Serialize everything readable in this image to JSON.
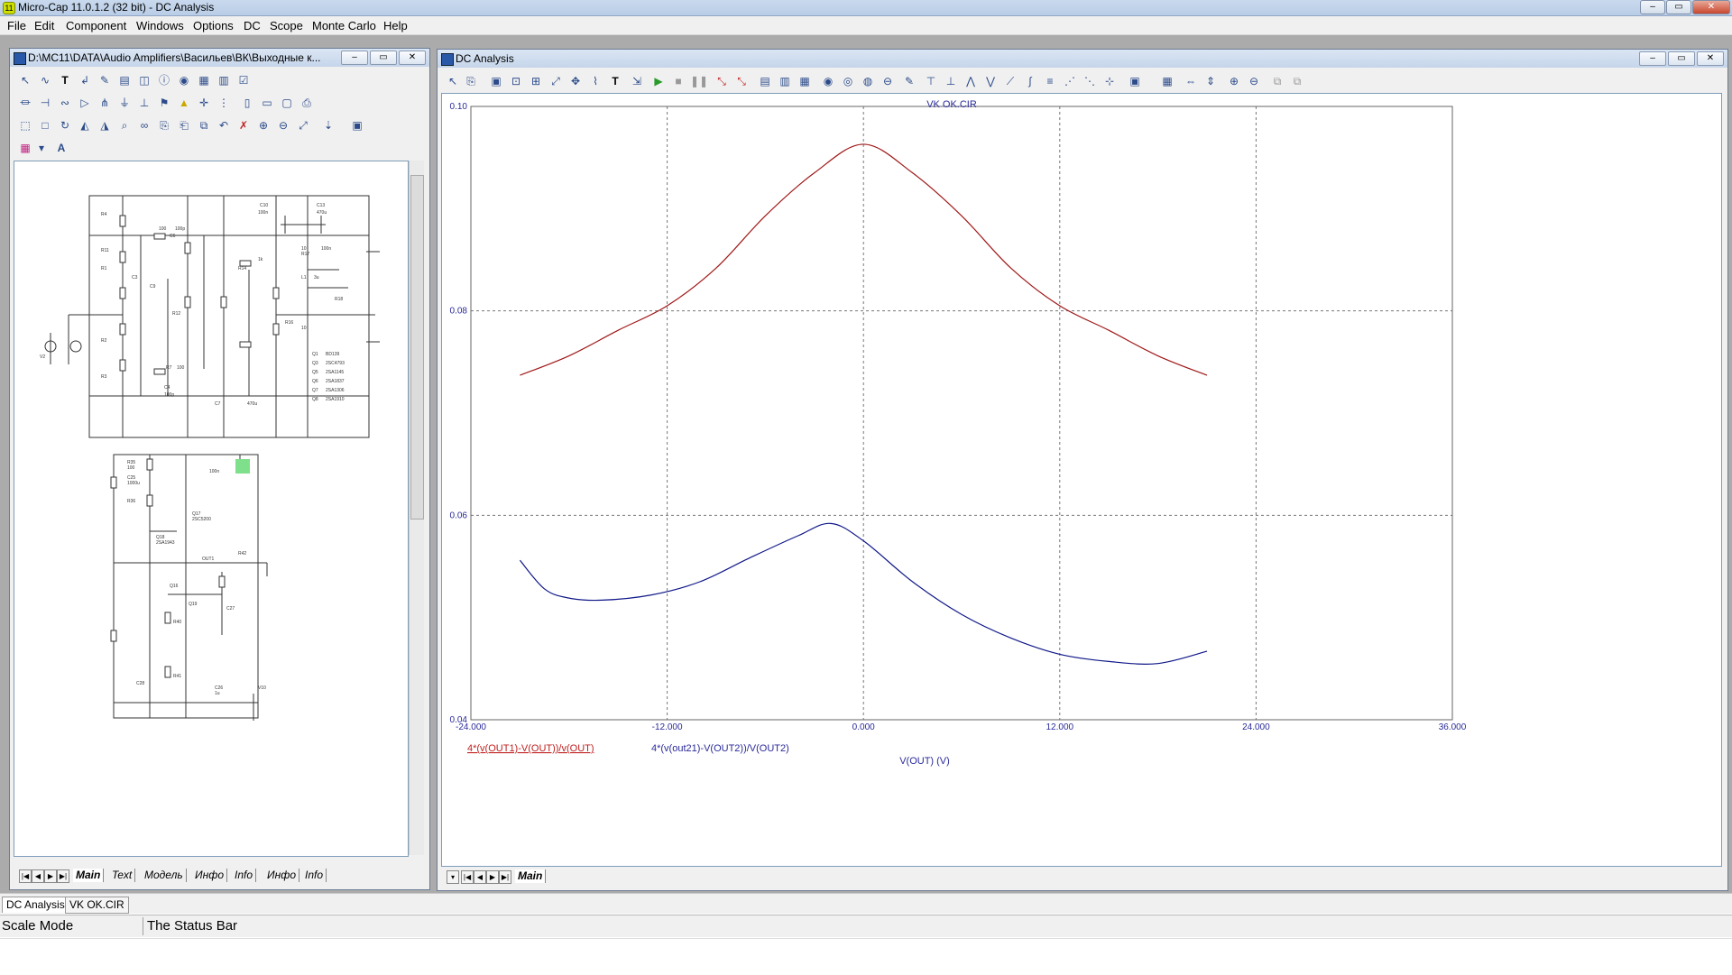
{
  "window": {
    "title": "Micro-Cap 11.0.1.2 (32 bit) - DC Analysis",
    "minimize": "–",
    "maximize": "▭",
    "close": "✕"
  },
  "menu": [
    "File",
    "Edit",
    "Component",
    "Windows",
    "Options",
    "DC",
    "Scope",
    "Monte Carlo",
    "Help"
  ],
  "schematic": {
    "title": "D:\\MC11\\DATA\\Audio Amplifiers\\Васильев\\ВК\\Выходные к...",
    "tabs": [
      "Main",
      "Text",
      "Модель",
      "Инфо",
      "Info",
      "Инфо",
      "Info"
    ],
    "labels_top": [
      "100",
      "100p",
      "C6",
      "C10",
      "C13",
      "100n",
      "470u",
      "R17",
      "10",
      "100n",
      "R18",
      "R4",
      "R11",
      "R1",
      "R14",
      "C3",
      "C9",
      "R12",
      "L1",
      "3u",
      "R16",
      "10",
      "R2",
      "R3",
      "V2",
      "C4",
      "100p",
      "C7",
      "R7",
      "100",
      "470u",
      "Q1",
      "Q3",
      "Q5",
      "Q6",
      "Q7",
      "Q8",
      "BD139",
      "2SC4793",
      "2SA1145",
      "2SA1837",
      "2SA1306",
      "2SA1910",
      "1k"
    ],
    "labels_bottom": [
      "R35",
      "100",
      "C25",
      "1000u",
      "R36",
      "Q17",
      "2SC5200",
      "Q18",
      "2SA1943",
      "Q19",
      "Q16",
      "R40",
      "R41",
      "OUT1",
      "R42",
      "C27",
      "C26",
      "C28",
      "V10",
      "1u",
      "100n"
    ]
  },
  "plot": {
    "window_title": "DC Analysis",
    "tabs": [
      "Main"
    ],
    "status_label": "The Status Bar"
  },
  "chart_data": {
    "type": "line",
    "title": "VK OK.CIR",
    "xlabel": "V(OUT) (V)",
    "ylabel": "",
    "xlim": [
      -24,
      36
    ],
    "ylim": [
      0.04,
      0.1
    ],
    "x_ticks": [
      "-24.000",
      "-12.000",
      "0.000",
      "12.000",
      "24.000",
      "36.000"
    ],
    "y_ticks": [
      "0.04",
      "0.06",
      "0.08",
      "0.10"
    ],
    "grid": true,
    "legend": "bottom-left",
    "series": [
      {
        "name": "4*(v(OUT1)-V(OUT))/v(OUT)",
        "color": "#a01818",
        "x": [
          -21,
          -18,
          -15,
          -12,
          -9,
          -6,
          -3,
          0,
          3,
          6,
          9,
          12,
          15,
          18,
          21
        ],
        "y": [
          0.0737,
          0.0756,
          0.0781,
          0.0805,
          0.0842,
          0.0893,
          0.0935,
          0.0963,
          0.0935,
          0.0893,
          0.0842,
          0.0805,
          0.0781,
          0.0756,
          0.0737
        ]
      },
      {
        "name": "4*(v(out21)-V(OUT2))/V(OUT2)",
        "color": "#101888",
        "x": [
          -21,
          -19.5,
          -18,
          -16,
          -13,
          -10,
          -7,
          -4,
          -2,
          0,
          3,
          6,
          9,
          12,
          15,
          18,
          21
        ],
        "y": [
          0.0556,
          0.0528,
          0.0519,
          0.0517,
          0.0522,
          0.0535,
          0.0558,
          0.058,
          0.0592,
          0.0575,
          0.0535,
          0.0503,
          0.048,
          0.0464,
          0.0457,
          0.0455,
          0.0467
        ]
      }
    ]
  },
  "docbar": {
    "tabs": [
      "DC Analysis",
      "VK OK.CIR"
    ]
  },
  "statusbar": {
    "mode": "Scale Mode",
    "message": "The Status Bar"
  }
}
